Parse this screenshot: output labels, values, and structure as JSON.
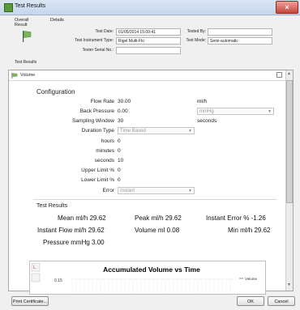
{
  "window": {
    "title": "Test Results",
    "close_label": "×"
  },
  "tabs": {
    "overall": "Overall Result",
    "details": "Details"
  },
  "details": {
    "test_date_label": "Test Date:",
    "test_date_value": "01/05/2014 15:09:41",
    "instrument_type_label": "Test Instrument Type:",
    "instrument_type_value": "Rigel Multi-Flo",
    "tester_serial_label": "Tester Serial No.:",
    "tester_serial_value": "",
    "tested_by_label": "Tested By:",
    "tested_by_value": "",
    "test_mode_label": "Test Mode:",
    "test_mode_value": "Semi-automatic"
  },
  "section_label": "Test Results",
  "panel": {
    "header": "Volume",
    "config_title": "Configuration",
    "flow_rate_label": "Flow Rate",
    "flow_rate_value": "30.00",
    "flow_rate_unit": "ml/h",
    "back_pressure_label": "Back Pressure",
    "back_pressure_value": "0.00",
    "back_pressure_unit": "mmHg",
    "sampling_window_label": "Sampling Window",
    "sampling_window_value": "30",
    "sampling_window_unit": "seconds",
    "duration_type_label": "Duration Type",
    "duration_type_value": "Time Based",
    "hours_label": "hours",
    "hours_value": "0",
    "minutes_label": "minutes",
    "minutes_value": "0",
    "seconds_label": "seconds",
    "seconds_value": "10",
    "upper_limit_label": "Upper Limit %",
    "upper_limit_value": "0",
    "lower_limit_label": "Lower Limit %",
    "lower_limit_value": "0",
    "error_label": "Error",
    "error_value": "Instant",
    "results_title": "Test Results",
    "mean_label": "Mean ml/h",
    "mean_value": "29.62",
    "peak_label": "Peak ml/h",
    "peak_value": "29.62",
    "instant_error_label": "Instant Error %",
    "instant_error_value": "-1.26",
    "instant_flow_label": "Instant Flow ml/h",
    "instant_flow_value": "29.62",
    "volume_label": "Volume ml",
    "volume_value": "0.08",
    "min_label": "Min ml/h",
    "min_value": "29.62",
    "pressure_label": "Pressure mmHg",
    "pressure_value": "3.00"
  },
  "chart_data": {
    "type": "line",
    "title": "Accumulated Volume vs Time",
    "ytick_top": "0.15",
    "legend": "Volume"
  },
  "buttons": {
    "print": "Print Certificate...",
    "ok": "OK",
    "cancel": "Cancel"
  }
}
